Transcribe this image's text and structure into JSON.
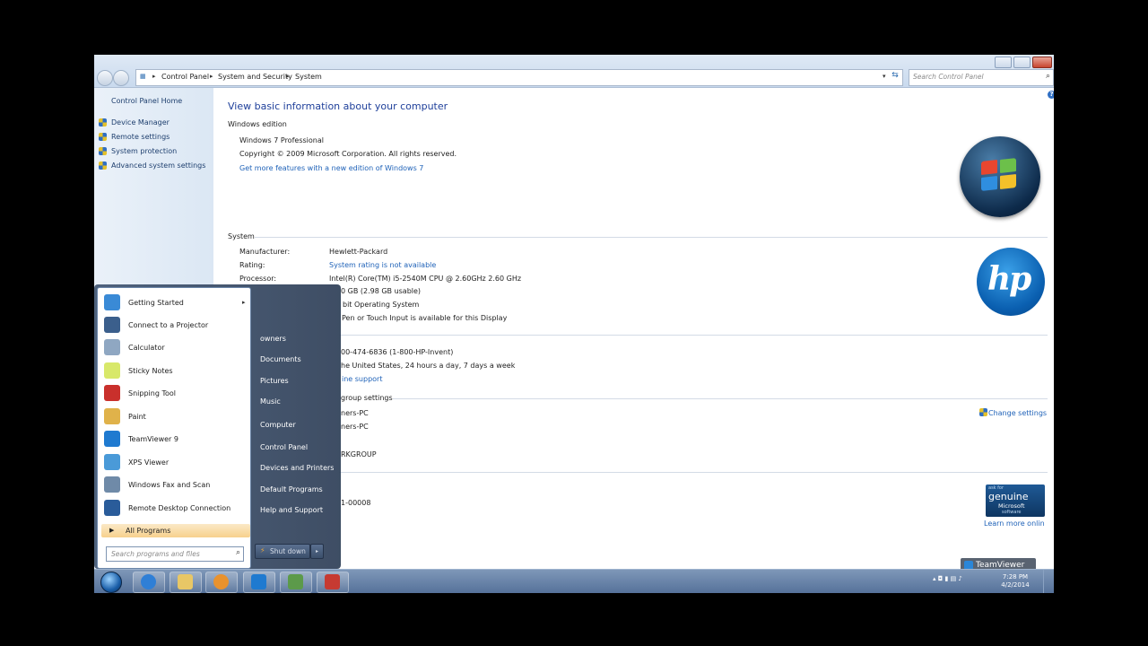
{
  "window": {
    "breadcrumb": [
      "Control Panel",
      "System and Security",
      "System"
    ],
    "search_placeholder": "Search Control Panel"
  },
  "left_pane": {
    "home": "Control Panel Home",
    "items": [
      "Device Manager",
      "Remote settings",
      "System protection",
      "Advanced system settings"
    ]
  },
  "main": {
    "title": "View basic information about your computer",
    "windows_edition": {
      "heading": "Windows edition",
      "edition": "Windows 7 Professional",
      "copyright": "Copyright © 2009 Microsoft Corporation.  All rights reserved.",
      "upgrade_link": "Get more features with a new edition of Windows 7"
    },
    "system": {
      "heading": "System",
      "manufacturer_label": "Manufacturer:",
      "manufacturer_value": "Hewlett-Packard",
      "rating_label": "Rating:",
      "rating_value": "System rating is not available",
      "processor_label": "Processor:",
      "processor_value": "Intel(R) Core(TM) i5-2540M CPU @ 2.60GHz   2.60 GHz",
      "ram_value": "0 GB (2.98 GB usable)",
      "type_value": "bit Operating System",
      "pen_value": "Pen or Touch Input is available for this Display"
    },
    "support": {
      "phone": "00-474-6836 (1-800-HP-Invent)",
      "hours": "he United States, 24 hours a day, 7 days a week",
      "online_link": "ine support"
    },
    "computer_name": {
      "heading": "group settings",
      "name": "ners-PC",
      "full_name": "ners-PC",
      "workgroup": "RKGROUP",
      "change_settings": "Change settings"
    },
    "activation": {
      "product_id": "1-00008",
      "genuine_top": "ask for",
      "genuine_main": "genuine",
      "genuine_brand": "Microsoft",
      "genuine_sub": "software",
      "learn_more": "Learn more onlin"
    },
    "hp_logo_text": "hp"
  },
  "start_menu": {
    "programs": [
      {
        "label": "Getting Started",
        "icon": "getting-started-icon",
        "color": "#3a8ad6",
        "submenu": true
      },
      {
        "label": "Connect to a Projector",
        "icon": "projector-icon",
        "color": "#3b5f8c",
        "submenu": false
      },
      {
        "label": "Calculator",
        "icon": "calculator-icon",
        "color": "#8fa7c2",
        "submenu": false
      },
      {
        "label": "Sticky Notes",
        "icon": "sticky-notes-icon",
        "color": "#d8e86a",
        "submenu": false
      },
      {
        "label": "Snipping Tool",
        "icon": "scissors-icon",
        "color": "#c9302c",
        "submenu": false
      },
      {
        "label": "Paint",
        "icon": "paint-icon",
        "color": "#e0b24a",
        "submenu": false
      },
      {
        "label": "TeamViewer 9",
        "icon": "teamviewer-icon",
        "color": "#1f7ad0",
        "submenu": false
      },
      {
        "label": "XPS Viewer",
        "icon": "xps-viewer-icon",
        "color": "#4a9ad8",
        "submenu": false
      },
      {
        "label": "Windows Fax and Scan",
        "icon": "fax-scan-icon",
        "color": "#6f8aa8",
        "submenu": false
      },
      {
        "label": "Remote Desktop Connection",
        "icon": "remote-desktop-icon",
        "color": "#2a5c9a",
        "submenu": false
      }
    ],
    "all_programs": "All Programs",
    "search_placeholder": "Search programs and files",
    "places": [
      "owners",
      "Documents",
      "Pictures",
      "Music",
      "Computer",
      "Control Panel",
      "Devices and Printers",
      "Default Programs",
      "Help and Support"
    ],
    "shutdown": "Shut down"
  },
  "taskbar": {
    "apps": [
      {
        "name": "internet-explorer-icon",
        "color": "#2f7fd6"
      },
      {
        "name": "folder-icon",
        "color": "#e8c766"
      },
      {
        "name": "media-player-icon",
        "color": "#e8922e"
      },
      {
        "name": "teamviewer-icon",
        "color": "#1f7ad0"
      },
      {
        "name": "control-panel-icon",
        "color": "#5c9a4a"
      },
      {
        "name": "briefcase-icon",
        "color": "#c63a32"
      }
    ],
    "time": "7:28 PM",
    "date": "4/2/2014"
  },
  "teamviewer_badge": "TeamViewer"
}
